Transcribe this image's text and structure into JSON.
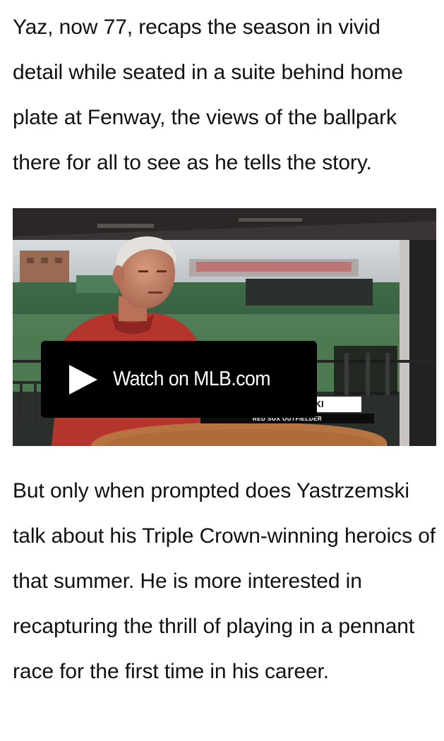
{
  "article": {
    "paragraph_1": "Yaz, now 77, recaps the season in vivid detail while seated in a suite behind home plate at Fenway, the views of the ballpark there for all to see as he tells the story.",
    "paragraph_2": "But only when prompted does Yastrzemski talk about his Triple Crown-winning heroics of that summer. He is more interested in recapturing the thrill of playing in a pennant race for the first time in his career."
  },
  "video": {
    "play_label": "Watch on MLB.com",
    "play_icon": "play-icon",
    "lower_third_name": "SKI",
    "lower_third_title": "RED SOX OUTFIELDER"
  },
  "colors": {
    "text": "#111111",
    "overlay": "#000000",
    "shirt_red": "#b5352d",
    "field_green": "#4e7a52"
  }
}
